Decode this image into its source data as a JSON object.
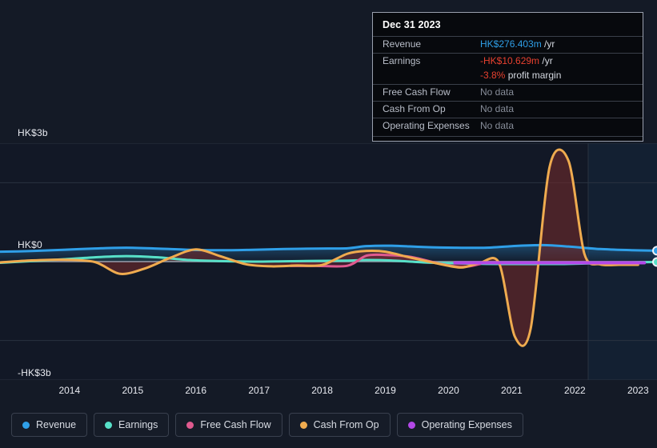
{
  "chart_data": {
    "type": "line",
    "title": "",
    "xlabel": "",
    "ylabel": "HK$",
    "currency": "HK$",
    "ylim": [
      -3000,
      3000
    ],
    "y_ticks": [
      {
        "value": 3000,
        "label": "HK$3b"
      },
      {
        "value": 0,
        "label": "HK$0"
      },
      {
        "value": -3000,
        "label": "-HK$3b"
      }
    ],
    "grid": true,
    "legend_position": "bottom-left",
    "x_ticks": [
      "2014",
      "2015",
      "2016",
      "2017",
      "2018",
      "2019",
      "2020",
      "2021",
      "2022",
      "2023"
    ],
    "x_domain": [
      2013.4,
      2023.8
    ],
    "series": [
      {
        "name": "Revenue",
        "color": "#2f9fe8",
        "x": [
          2013.4,
          2013.9,
          2014.4,
          2014.9,
          2015.4,
          2015.9,
          2016.4,
          2016.9,
          2017.4,
          2017.9,
          2018.4,
          2018.9,
          2019.2,
          2019.6,
          2020.1,
          2020.6,
          2021.1,
          2021.6,
          2022.0,
          2022.4,
          2022.9,
          2023.4,
          2023.8
        ],
        "values": [
          250,
          268,
          300,
          332,
          352,
          330,
          300,
          288,
          300,
          318,
          330,
          338,
          392,
          402,
          370,
          352,
          352,
          400,
          418,
          382,
          318,
          290,
          276
        ],
        "endpoint_dot": true
      },
      {
        "name": "Earnings",
        "color": "#57e0c8",
        "x": [
          2013.4,
          2013.9,
          2014.4,
          2014.9,
          2015.4,
          2015.9,
          2016.4,
          2016.9,
          2017.4,
          2017.9,
          2018.4,
          2018.9,
          2019.2,
          2019.6,
          2020.1,
          2020.6,
          2021.1,
          2021.6,
          2022.0,
          2022.4,
          2022.9,
          2023.4,
          2023.8
        ],
        "values": [
          -30,
          12,
          58,
          110,
          140,
          108,
          40,
          12,
          0,
          8,
          18,
          26,
          40,
          28,
          -20,
          -42,
          -58,
          -60,
          -62,
          -58,
          -38,
          -20,
          -11
        ],
        "endpoint_dot": true
      },
      {
        "name": "Free Cash Flow",
        "color": "#e05a8f",
        "x": [
          2018.0,
          2018.4,
          2018.9,
          2019.2,
          2019.5,
          2019.9,
          2020.3,
          2020.7,
          2021.0
        ],
        "values": [
          -110,
          -108,
          -105,
          150,
          168,
          120,
          -30,
          -140,
          -60
        ],
        "endpoint_dot": false
      },
      {
        "name": "Cash From Op",
        "color": "#efab4f",
        "x": [
          2013.4,
          2013.9,
          2014.4,
          2014.9,
          2015.3,
          2015.7,
          2016.1,
          2016.5,
          2016.9,
          2017.3,
          2017.7,
          2018.1,
          2018.5,
          2018.9,
          2019.2,
          2019.5,
          2019.9,
          2020.3,
          2020.7,
          2021.0,
          2021.3,
          2021.55,
          2021.8,
          2022.1,
          2022.4,
          2022.65,
          2022.9,
          2023.2,
          2023.5
        ],
        "values": [
          -20,
          30,
          48,
          -10,
          -310,
          -170,
          100,
          310,
          130,
          -70,
          -120,
          -100,
          -85,
          200,
          270,
          250,
          100,
          -40,
          -150,
          -30,
          -40,
          -1900,
          -1700,
          2400,
          2550,
          200,
          -70,
          -80,
          -80
        ],
        "endpoint_dot": false
      },
      {
        "name": "Operating Expenses",
        "color": "#b348e8",
        "x": [
          2020.6,
          2021.1,
          2021.6,
          2022.1,
          2022.6,
          2023.1,
          2023.6
        ],
        "values": [
          -30,
          -30,
          -30,
          -30,
          -30,
          -30,
          -30
        ],
        "endpoint_dot": false
      }
    ]
  },
  "tooltip": {
    "date": "Dec 31 2023",
    "rows": [
      {
        "key": "Revenue",
        "value": "HK$276.403m",
        "unit": " /yr",
        "style": "rev"
      },
      {
        "key": "Earnings",
        "value": "-HK$10.629m",
        "unit": " /yr",
        "style": "earn"
      },
      {
        "key": "",
        "value": "-3.8%",
        "unit": " profit margin",
        "style": "marg",
        "sub": true
      },
      {
        "key": "Free Cash Flow",
        "value": "No data",
        "unit": "",
        "style": "none"
      },
      {
        "key": "Cash From Op",
        "value": "No data",
        "unit": "",
        "style": "none"
      },
      {
        "key": "Operating Expenses",
        "value": "No data",
        "unit": "",
        "style": "none"
      }
    ]
  },
  "legend": {
    "items": [
      {
        "label": "Revenue",
        "color": "#2f9fe8"
      },
      {
        "label": "Earnings",
        "color": "#57e0c8"
      },
      {
        "label": "Free Cash Flow",
        "color": "#e05a8f"
      },
      {
        "label": "Cash From Op",
        "color": "#efab4f"
      },
      {
        "label": "Operating Expenses",
        "color": "#b348e8"
      }
    ]
  },
  "colors": {
    "background": "#141a26",
    "plot_background": "#121826",
    "gridline": "#2a3240",
    "zero_line": "#9aa0ae",
    "axis_text": "#e8eaf0",
    "highlight_band": "#14283c"
  }
}
